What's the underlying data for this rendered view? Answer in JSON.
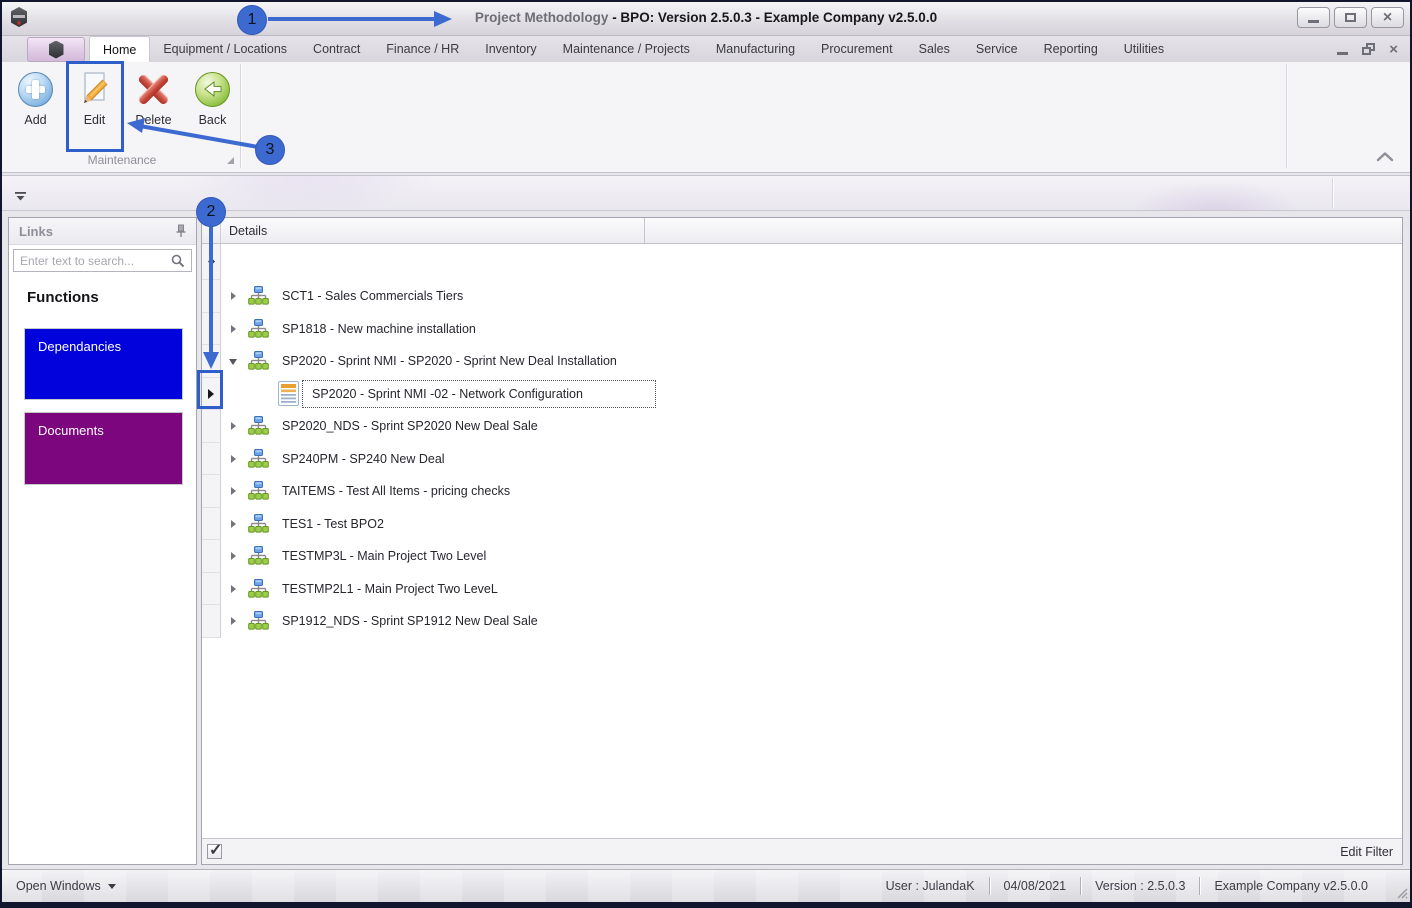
{
  "annotation_color": "#3d6ad1",
  "window": {
    "title_gray": "Project Methodology",
    "title_bold": " - BPO: Version 2.5.0.3 - Example Company v2.5.0.0"
  },
  "tabs": {
    "selected": "Home",
    "items": [
      "Home",
      "Equipment / Locations",
      "Contract",
      "Finance / HR",
      "Inventory",
      "Maintenance / Projects",
      "Manufacturing",
      "Procurement",
      "Sales",
      "Service",
      "Reporting",
      "Utilities"
    ]
  },
  "ribbon": {
    "group_label": "Maintenance",
    "buttons": [
      {
        "label": "Add",
        "icon": "add-icon"
      },
      {
        "label": "Edit",
        "icon": "edit-icon"
      },
      {
        "label": "Delete",
        "icon": "delete-icon"
      },
      {
        "label": "Back",
        "icon": "back-icon"
      }
    ]
  },
  "links_panel": {
    "title": "Links",
    "pin_icon": "pin-icon",
    "search_placeholder": "Enter text to search...",
    "search_icon": "magnifier-icon",
    "section_title": "Functions",
    "items": [
      {
        "label": "Dependancies",
        "color": "#0202dd"
      },
      {
        "label": "Documents",
        "color": "#7c067e"
      }
    ]
  },
  "grid": {
    "column_header": "Details",
    "rows": [
      {
        "label": "SCT1 - Sales Commercials Tiers",
        "level": 0,
        "expanded": false,
        "icon": "org",
        "selected": false
      },
      {
        "label": "SP1818 - New machine installation",
        "level": 0,
        "expanded": false,
        "icon": "org",
        "selected": false
      },
      {
        "label": "SP2020 - Sprint NMI - SP2020 - Sprint New Deal Installation",
        "level": 0,
        "expanded": true,
        "icon": "org",
        "selected": false
      },
      {
        "label": "SP2020 - Sprint NMI -02 - Network Configuration",
        "level": 1,
        "expanded": false,
        "icon": "doc",
        "selected": true
      },
      {
        "label": "SP2020_NDS - Sprint SP2020 New Deal Sale",
        "level": 0,
        "expanded": false,
        "icon": "org",
        "selected": false
      },
      {
        "label": "SP240PM - SP240 New Deal",
        "level": 0,
        "expanded": false,
        "icon": "org",
        "selected": false
      },
      {
        "label": "TAITEMS - Test All Items - pricing checks",
        "level": 0,
        "expanded": false,
        "icon": "org",
        "selected": false
      },
      {
        "label": "TES1 - Test BPO2",
        "level": 0,
        "expanded": false,
        "icon": "org",
        "selected": false
      },
      {
        "label": "TESTMP3L - Main Project Two Level",
        "level": 0,
        "expanded": false,
        "icon": "org",
        "selected": false
      },
      {
        "label": "TESTMP2L1 - Main Project Two LeveL",
        "level": 0,
        "expanded": false,
        "icon": "org",
        "selected": false
      },
      {
        "label": "SP1912_NDS - Sprint SP1912 New Deal Sale",
        "level": 0,
        "expanded": false,
        "icon": "org",
        "selected": false
      }
    ],
    "footer": {
      "edit_filter_label": "Edit Filter",
      "checkbox_checked": true
    }
  },
  "statusbar": {
    "open_windows_label": "Open Windows",
    "cells": [
      "User : JulandaK",
      "04/08/2021",
      "Version : 2.5.0.3",
      "Example Company v2.5.0.0"
    ]
  },
  "annotations": {
    "step1": "1",
    "step2": "2",
    "step3": "3"
  }
}
